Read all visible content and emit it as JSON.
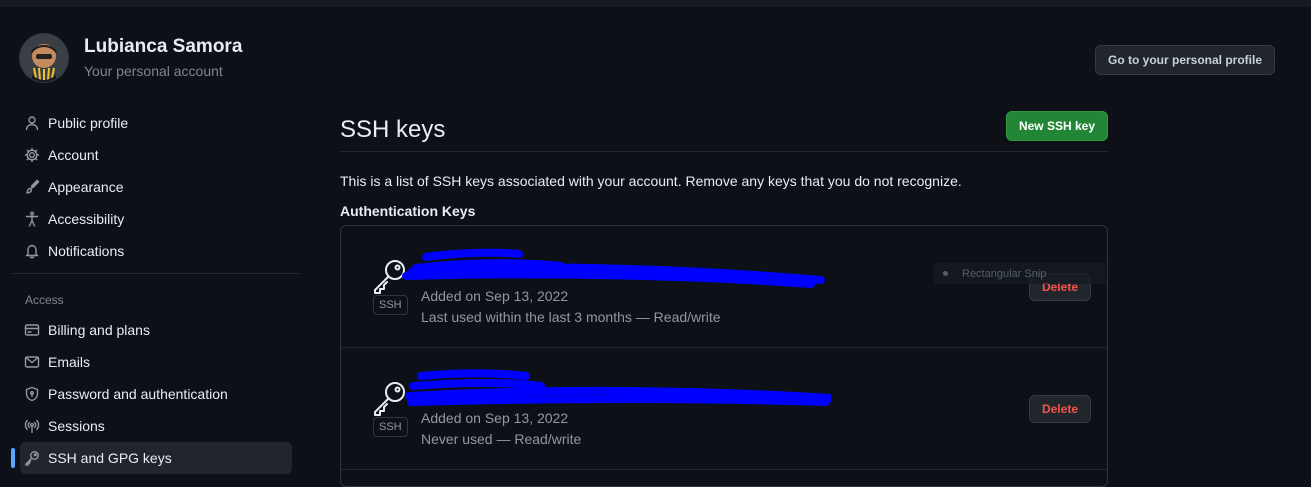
{
  "user": {
    "name": "Lubianca Samora",
    "subtitle": "Your personal account"
  },
  "header": {
    "profile_button": "Go to your personal profile"
  },
  "sidebar": {
    "items": [
      {
        "label": "Public profile",
        "icon": "person-icon"
      },
      {
        "label": "Account",
        "icon": "gear-icon"
      },
      {
        "label": "Appearance",
        "icon": "paintbrush-icon"
      },
      {
        "label": "Accessibility",
        "icon": "accessibility-icon"
      },
      {
        "label": "Notifications",
        "icon": "bell-icon"
      }
    ],
    "access_heading": "Access",
    "access_items": [
      {
        "label": "Billing and plans",
        "icon": "credit-card-icon"
      },
      {
        "label": "Emails",
        "icon": "mail-icon"
      },
      {
        "label": "Password and authentication",
        "icon": "shield-lock-icon"
      },
      {
        "label": "Sessions",
        "icon": "broadcast-icon"
      },
      {
        "label": "SSH and GPG keys",
        "icon": "key-icon",
        "active": true
      }
    ]
  },
  "main": {
    "title": "SSH keys",
    "new_button": "New SSH key",
    "intro": "This is a list of SSH keys associated with your account. Remove any keys that you do not recognize.",
    "section_title": "Authentication Keys",
    "keys": [
      {
        "badge": "SSH",
        "added": "Added on Sep 13, 2022",
        "usage": "Last used within the last 3 months — Read/write",
        "delete": "Delete"
      },
      {
        "badge": "SSH",
        "added": "Added on Sep 13, 2022",
        "usage": "Never used — Read/write",
        "delete": "Delete"
      }
    ]
  },
  "overlay": {
    "label": "Rectangular Snip"
  },
  "colors": {
    "background": "#0d1117",
    "accent": "#58a6ff",
    "primary_button": "#238636",
    "danger": "#f85149",
    "redaction": "#0000ff"
  }
}
